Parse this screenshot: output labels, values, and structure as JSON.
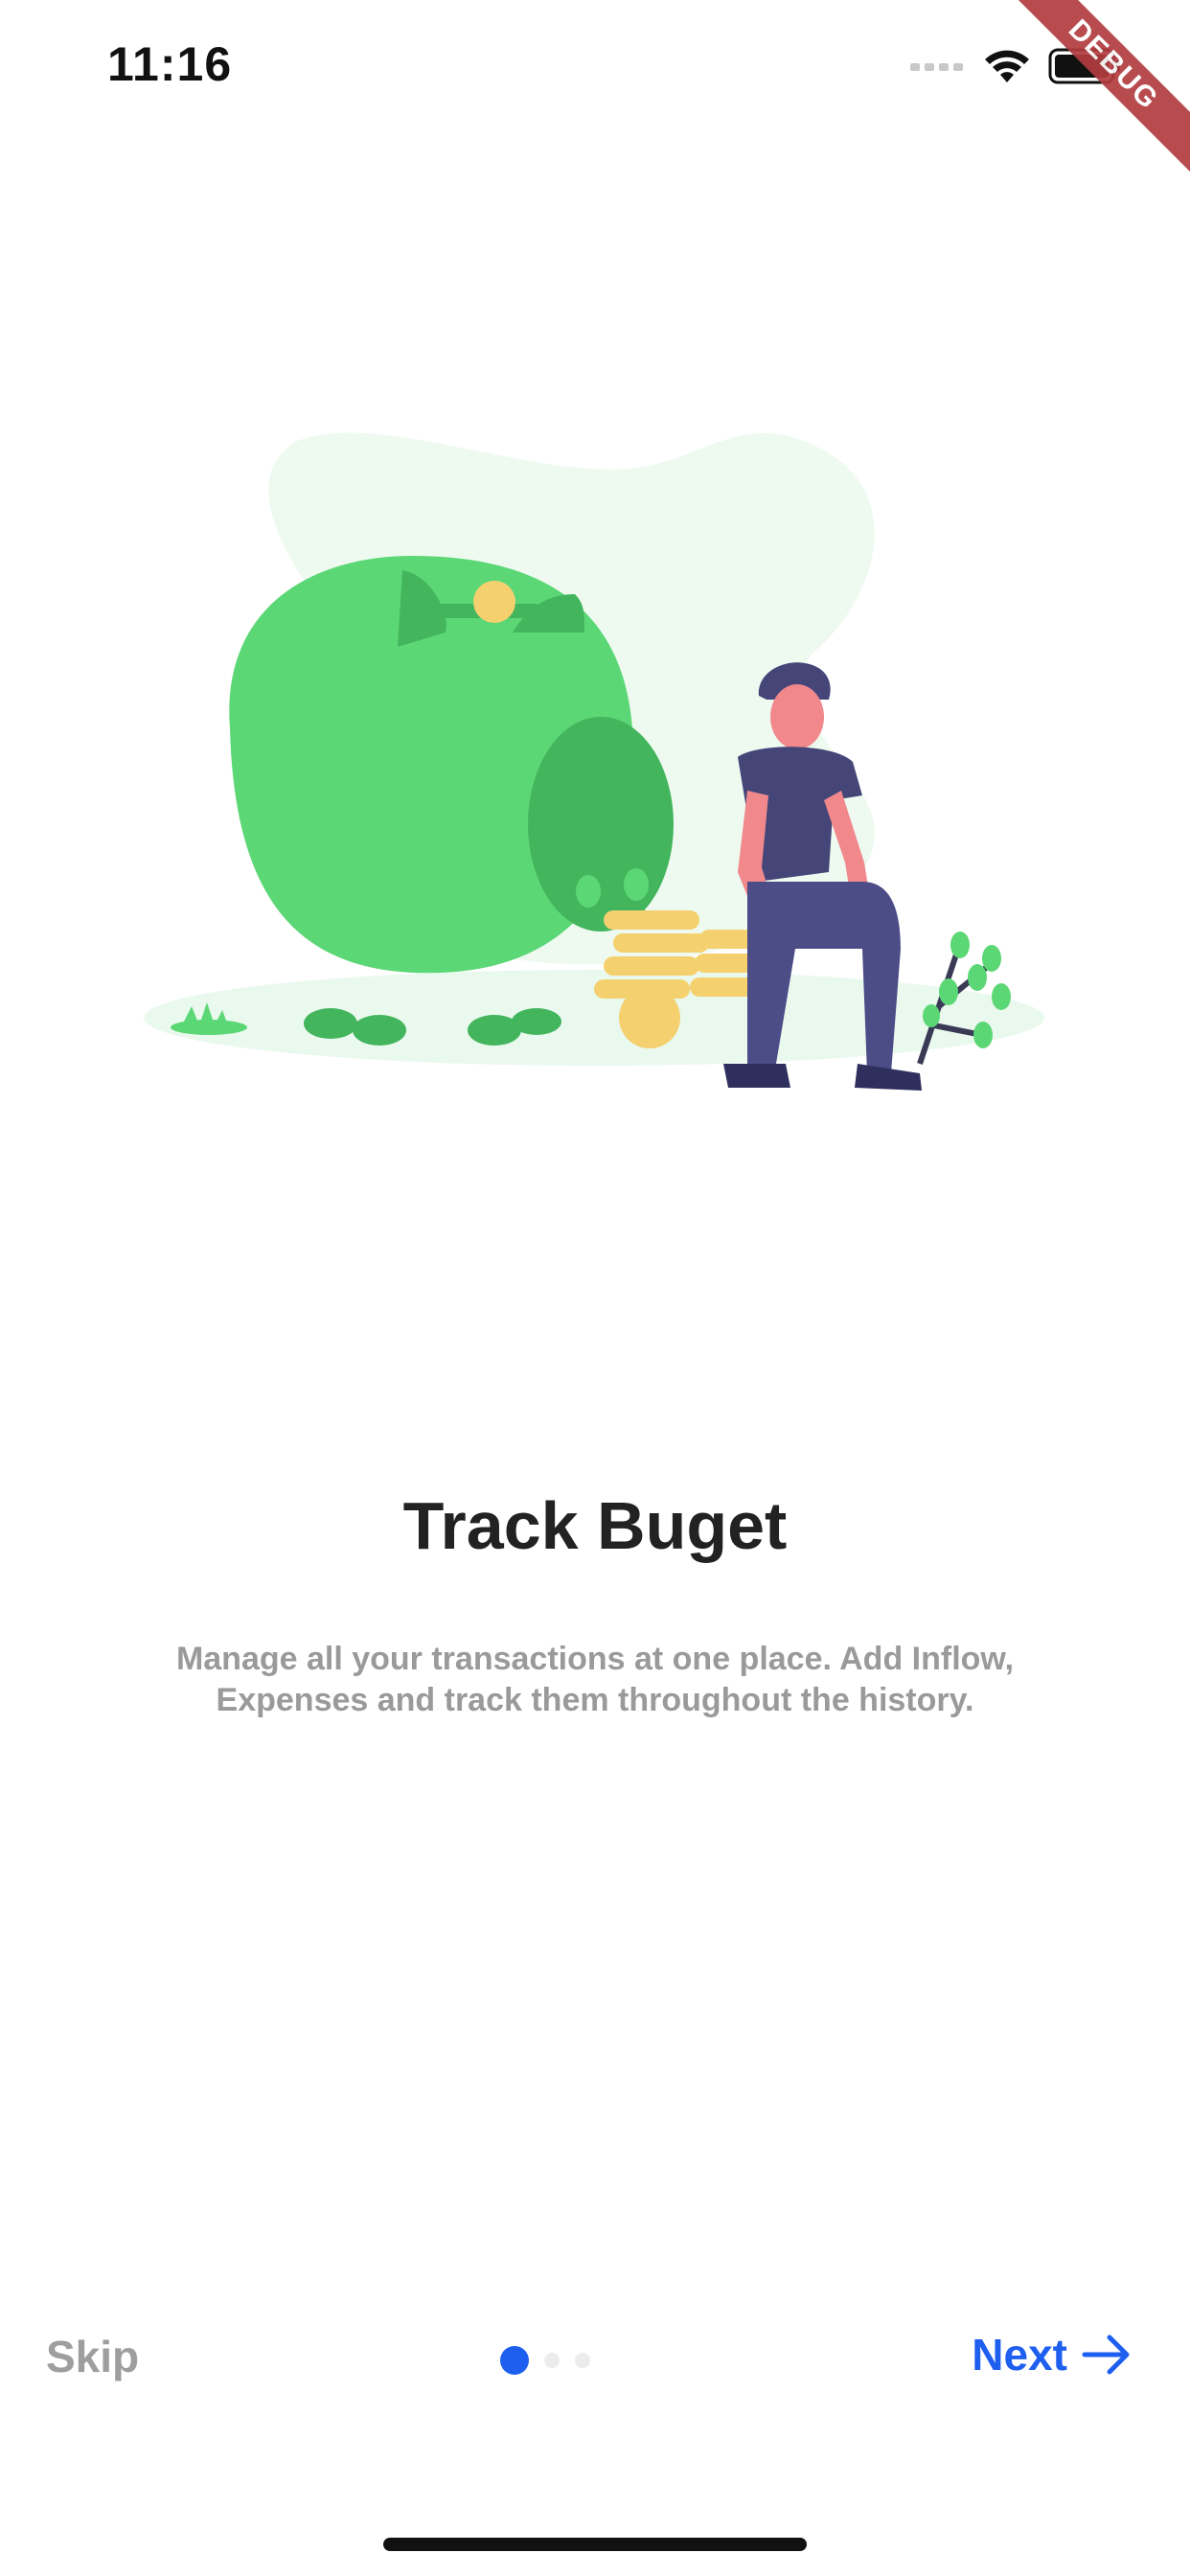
{
  "status_bar": {
    "time": "11:16",
    "icons": [
      "signal-dots-icon",
      "wifi-icon",
      "battery-icon"
    ],
    "debug_banner": "DEBUG"
  },
  "onboarding": {
    "title": "Track Buget",
    "description": "Manage all your transactions at one place. Add Inflow, Expenses and track them throughout the history.",
    "illustration": "piggy-bank-illustration"
  },
  "footer": {
    "skip_label": "Skip",
    "next_label": "Next",
    "page_count": 3,
    "current_page": 1
  },
  "colors": {
    "accent": "#1f5ff0",
    "title": "#222222",
    "muted": "#9a9a9a",
    "piggy": "#5cd776",
    "coin": "#f4d06f",
    "figure": "#454578"
  }
}
